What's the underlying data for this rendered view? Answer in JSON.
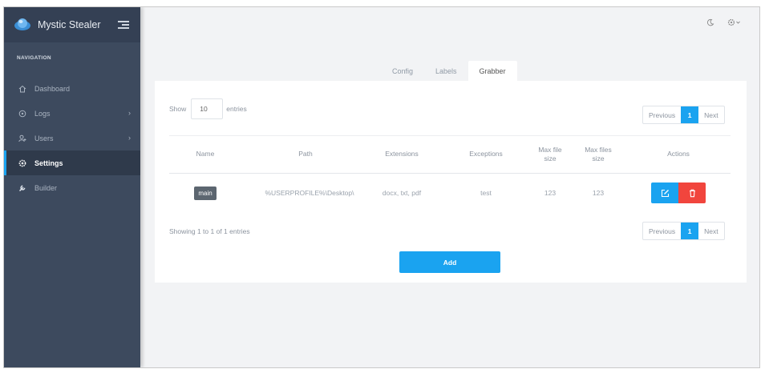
{
  "app": {
    "name": "Mystic Stealer"
  },
  "sidebar": {
    "heading": "NAVIGATION",
    "items": [
      {
        "label": "Dashboard",
        "icon": "home-icon"
      },
      {
        "label": "Logs",
        "icon": "logs-icon"
      },
      {
        "label": "Users",
        "icon": "users-icon"
      },
      {
        "label": "Settings",
        "icon": "gear-icon"
      },
      {
        "label": "Builder",
        "icon": "wrench-icon"
      }
    ]
  },
  "tabs": [
    "Config",
    "Labels",
    "Grabber"
  ],
  "table": {
    "show_label": "Show",
    "page_length": "10",
    "entries_label": "entries",
    "columns": {
      "name": "Name",
      "path": "Path",
      "extensions": "Extensions",
      "exceptions": "Exceptions",
      "max_file_1": "Max file",
      "max_file_2": "size",
      "max_files_1": "Max files",
      "max_files_2": "size",
      "actions": "Actions"
    },
    "rows": [
      {
        "name": "main",
        "path": "%USERPROFILE%\\Desktop\\",
        "extensions": "docx, txt, pdf",
        "exceptions": "test",
        "max_file_size": "123",
        "max_files_size": "123"
      }
    ],
    "info": "Showing 1 to 1 of 1 entries",
    "pager": {
      "previous": "Previous",
      "current": "1",
      "next": "Next"
    }
  },
  "add_button": "Add",
  "colors": {
    "sidebar": "#3d4a5e",
    "accent": "#1aa3f0",
    "danger": "#f1453d"
  }
}
